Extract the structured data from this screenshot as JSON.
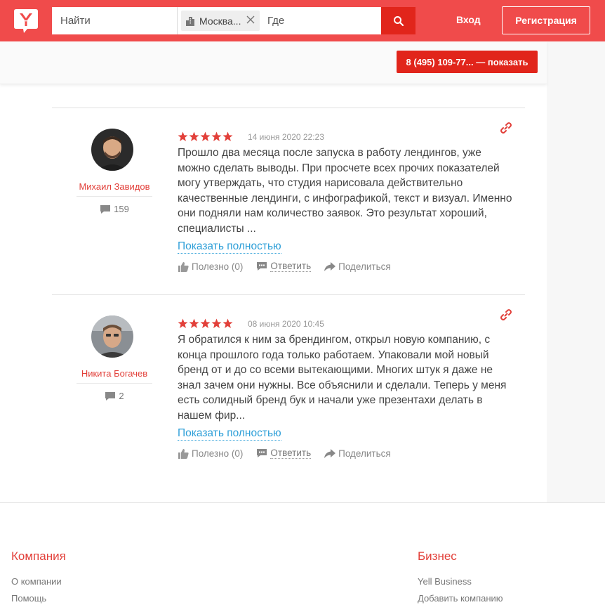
{
  "header": {
    "search_placeholder": "Найти",
    "city_chip": "Москва...",
    "where_placeholder": "Где",
    "login_label": "Вход",
    "register_label": "Регистрация",
    "brand_color": "#f04b4b"
  },
  "sticky": {
    "phone_button": "8 (495) 109-77... — показать"
  },
  "reviews": [
    {
      "author": "Михаил Завидов",
      "review_count": "159",
      "rating": 5,
      "date": "14 июня 2020 22:23",
      "text": "Прошло два месяца после запуска в работу лендингов, уже можно сделать выводы. При просчете всех прочих показателей могу утверждать, что студия нарисовала действительно качественные лендинги, с инфографикой, текст и визуал. Именно они подняли нам количество заявок. Это результат хороший, специалисты ...",
      "show_more": "Показать полностью",
      "helpful": "Полезно (0)",
      "reply": "Ответить",
      "share": "Поделиться"
    },
    {
      "author": "Никита Богачев",
      "review_count": "2",
      "rating": 5,
      "date": "08 июня 2020 10:45",
      "text": "Я обратился к ним за брендингом, открыл новую компанию, с конца прошлого года только работаем. Упаковали мой новый бренд от и до со всеми вытекающими. Многих штук я даже не знал зачем они нужны. Все объяснили и сделали. Теперь у меня есть солидный бренд бук и начали уже презентахи делать в нашем фир...",
      "show_more": "Показать полностью",
      "helpful": "Полезно (0)",
      "reply": "Ответить",
      "share": "Поделиться"
    }
  ],
  "footer": {
    "company": {
      "title": "Компания",
      "links": [
        "О компании",
        "Помощь"
      ]
    },
    "business": {
      "title": "Бизнес",
      "links": [
        "Yell Business",
        "Добавить компанию"
      ]
    }
  },
  "icons": {
    "logo": "yell-logo-icon",
    "city": "building-icon",
    "clear": "close-icon",
    "search": "search-icon",
    "link": "link-icon",
    "comment": "comment-icon",
    "like": "thumbs-up-icon",
    "reply": "reply-bubble-icon",
    "share": "share-arrow-icon"
  }
}
